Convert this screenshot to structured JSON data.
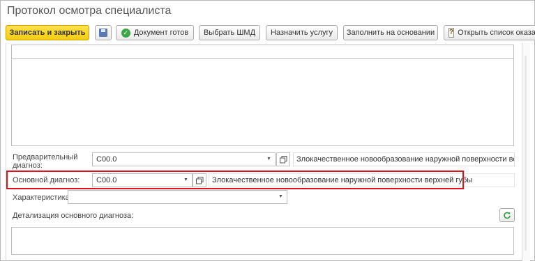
{
  "window": {
    "title": "Протокол осмотра специалиста"
  },
  "toolbar": {
    "save_close_label": "Записать и закрыть",
    "doc_ready_label": "Документ готов",
    "choose_shmd_label": "Выбрать ШМД",
    "assign_service_label": "Назначить услугу",
    "fill_based_label": "Заполнить на основании",
    "open_list_label": "Открыть список оказанн"
  },
  "form": {
    "preliminary_diagnosis": {
      "label": "Предварительный диагноз:",
      "code": "C00.0",
      "description": "Злокачественное новообразование наружной поверхности верхней"
    },
    "main_diagnosis": {
      "label": "Основной диагноз:",
      "code": "C00.0",
      "description": "Злокачественное новообразование наружной поверхности верхней губы"
    },
    "characteristic": {
      "label": "Характеристика:",
      "value": ""
    },
    "main_diagnosis_detail": {
      "label": "Детализация основного диагноза:",
      "value": ""
    }
  },
  "colors": {
    "primary_button": "#f5cc13",
    "highlight_border": "#e0121b",
    "success_icon": "#3aa745"
  },
  "icons": [
    "save-icon",
    "check-circle-icon",
    "help-book-icon",
    "dropdown-arrow-icon",
    "open-icon",
    "refresh-icon"
  ]
}
